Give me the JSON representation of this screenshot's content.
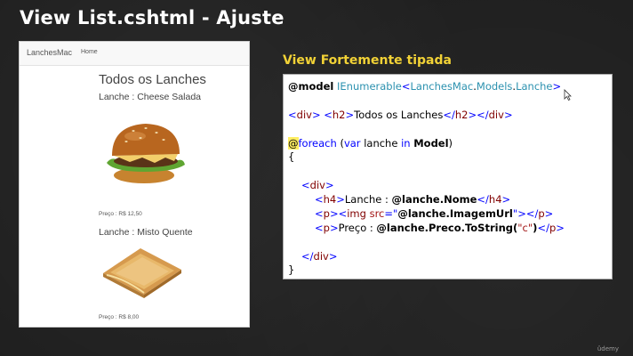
{
  "slide": {
    "title": "View List.cshtml - Ajuste",
    "watermark": "ûdemy"
  },
  "browser": {
    "brand": "LanchesMac",
    "nav_home": "Home",
    "page_title": "Todos os Lanches",
    "items": [
      {
        "heading": "Lanche : Cheese Salada",
        "price": "Preço : R$ 12,50",
        "image": "cheeseburger-image"
      },
      {
        "heading": "Lanche : Misto Quente",
        "price": "Preço : R$ 8,00",
        "image": "toasted-sandwich-image"
      }
    ]
  },
  "code": {
    "heading": "View Fortemente tipada",
    "line1": {
      "model_kw": "@model",
      "space": " ",
      "type": "IEnumerable",
      "lt": "<",
      "ns1": "LanchesMac",
      "dot1": ".",
      "ns2": "Models",
      "dot2": ".",
      "cls": "Lanche",
      "gt": ">"
    },
    "line2": {
      "open": "<",
      "div": "div",
      "close": ">",
      "space": " ",
      "open2": "<",
      "h2": "h2",
      "close2": ">",
      "text": "Todos os Lanches",
      "open3": "</",
      "h2b": "h2",
      "close3": ">",
      "open4": "</",
      "divb": "div",
      "close4": ">"
    },
    "line3": {
      "at": "@",
      "foreach": "foreach",
      "space": " (",
      "var": "var",
      "mid": " lanche ",
      "in": "in",
      "sp2": " ",
      "model": "Model",
      "end": ")"
    },
    "line4": "{",
    "line5": {
      "open": "<",
      "div": "div",
      "close": ">"
    },
    "line6": {
      "open": "<",
      "h4": "h4",
      "close": ">",
      "text": "Lanche : ",
      "expr": "@lanche.Nome",
      "open2": "</",
      "h4b": "h4",
      "close2": ">"
    },
    "line7": {
      "open": "<",
      "p": "p",
      "close": "><",
      "img": "img",
      "sp": " ",
      "src": "src",
      "eq": "=",
      "q1": "\"",
      "expr": "@lanche.ImagemUrl",
      "q2": "\"",
      "end": "></",
      "pb": "p",
      "close2": ">"
    },
    "line8": {
      "open": "<",
      "p": "p",
      "close": ">",
      "text": "Preço : ",
      "expr": "@lanche.Preco.ToString(",
      "str": "\"c\"",
      "rp": ")",
      "open2": "</",
      "pb": "p",
      "close2": ">"
    },
    "line9": {
      "open": "</",
      "div": "div",
      "close": ">"
    },
    "line10": "}"
  },
  "colors": {
    "keyword": "#0000ff",
    "type": "#2b91af",
    "string": "#a31515",
    "razor_highlight": "#ffee62",
    "heading_yellow": "#f2d236"
  }
}
